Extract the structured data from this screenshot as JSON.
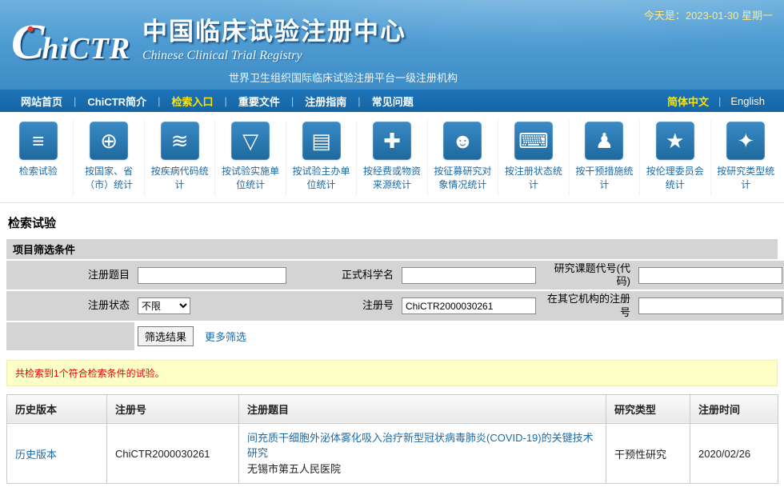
{
  "header": {
    "date_text": "今天是：2023-01-30 星期一",
    "logo_big": "C",
    "logo_rest": "hiCTR",
    "logo_dot": "•",
    "title": "中国临床试验注册中心",
    "subtitle": "Chinese Clinical Trial Registry",
    "tagline": "世界卫生组织国际临床试验注册平台一级注册机构"
  },
  "nav": {
    "items": [
      {
        "label": "网站首页"
      },
      {
        "label": "ChiCTR简介"
      },
      {
        "label": "检索入口"
      },
      {
        "label": "重要文件"
      },
      {
        "label": "注册指南"
      },
      {
        "label": "常见问题"
      }
    ],
    "lang_cn": "简体中文",
    "lang_en": "English"
  },
  "quicklinks": [
    {
      "label": "检索试验",
      "glyph": "≡"
    },
    {
      "label": "按国家、省（市）统计",
      "glyph": "⊕"
    },
    {
      "label": "按疾病代码统计",
      "glyph": "≋"
    },
    {
      "label": "按试验实施单位统计",
      "glyph": "▽"
    },
    {
      "label": "按试验主办单位统计",
      "glyph": "▤"
    },
    {
      "label": "按经费或物资来源统计",
      "glyph": "✚"
    },
    {
      "label": "按征募研究对象情况统计",
      "glyph": "☻"
    },
    {
      "label": "按注册状态统计",
      "glyph": "⌨"
    },
    {
      "label": "按干预措施统计",
      "glyph": "♟"
    },
    {
      "label": "按伦理委员会统计",
      "glyph": "★"
    },
    {
      "label": "按研究类型统计",
      "glyph": "✦"
    }
  ],
  "section": {
    "title": "检索试验"
  },
  "filter": {
    "header": "项目筛选条件",
    "fields": {
      "title_label": "注册题目",
      "scientific_label": "正式科学名",
      "code_label": "研究课题代号(代码)",
      "status_label": "注册状态",
      "status_value": "不限",
      "regno_label": "注册号",
      "regno_value": "ChiCTR2000030261",
      "other_label": "在其它机构的注册号"
    },
    "submit_label": "筛选结果",
    "more_label": "更多筛选"
  },
  "results": {
    "message": "共检索到1个符合检索条件的试验。",
    "columns": [
      "历史版本",
      "注册号",
      "注册题目",
      "研究类型",
      "注册时间"
    ],
    "rows": [
      {
        "history": "历史版本",
        "reg_no": "ChiCTR2000030261",
        "title": "间充质干细胞外泌体雾化吸入治疗新型冠状病毒肺炎(COVID-19)的关键技术研究",
        "org": "无锡市第五人民医院",
        "study_type": "干预性研究",
        "reg_date": "2020/02/26"
      }
    ]
  }
}
